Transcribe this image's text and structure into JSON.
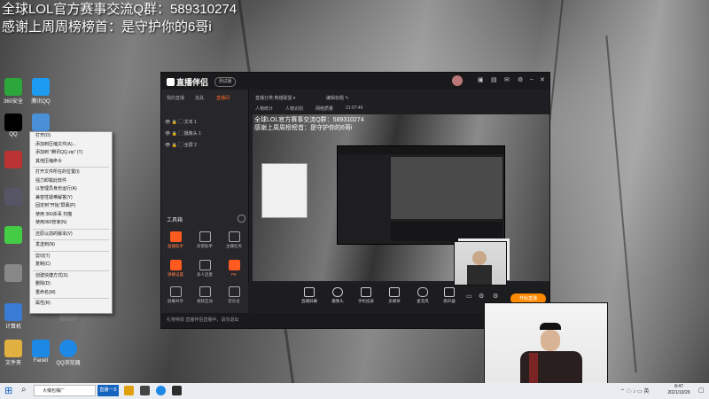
{
  "overlay": {
    "line1": "全球LOL官方赛事交流Q群：589310274",
    "line2": "感谢上周周榜榜首：是守护你的6哥i"
  },
  "desktop_icons": [
    {
      "label": "360安全",
      "color": "#2aa63a"
    },
    {
      "label": "腾讯QQ",
      "color": "#1d9bf0"
    },
    {
      "label": "QQ",
      "color": "#000000"
    },
    {
      "label": "回收站",
      "color": "#4a90d9"
    },
    {
      "label": "计算机",
      "color": "#3a7bd5"
    },
    {
      "label": "文件夹",
      "color": "#e0b040"
    },
    {
      "label": "Steam",
      "color": "#1b2838"
    },
    {
      "label": "Faceit",
      "color": "#ff5500"
    },
    {
      "label": "QQ浏览器",
      "color": "#1e88e5"
    }
  ],
  "context_menu": {
    "items": [
      "打开(O)",
      "添加到压缩文件(A)...",
      "添加到 \"腾讯QQ.zip\" (T)",
      "其他压缩命令",
      "",
      "打开文件所在的位置(I)",
      "强力卸载此软件",
      "以管理员身份运行(A)",
      "兼容性疑难解答(Y)",
      "固定到\"开始\"屏幕(P)",
      "使用 360杀毒 扫描",
      "使用360管家(N)",
      "",
      "还原以前的版本(V)",
      "",
      "发送到(N)",
      "",
      "剪切(T)",
      "复制(C)",
      "",
      "创建快捷方式(S)",
      "删除(D)",
      "重命名(M)",
      "",
      "属性(R)"
    ]
  },
  "app": {
    "name": "直播伴侣",
    "version": "测试版",
    "tabs": [
      "我的直播",
      "道具",
      "直播间"
    ],
    "scenes": [
      "文本 1",
      "摄像头 1",
      "全屏 2"
    ],
    "header": {
      "room_title": "直播分类:英雄联盟 ▾",
      "edit": "编辑标题 ✎",
      "status1": "人物统计",
      "status2": "人物识别",
      "status3": "网络质量",
      "time": "21:07:40"
    },
    "tools_title": "工具箱",
    "tools": [
      "直播助手",
      "房管助手",
      "主播任务",
      "弹幕设置",
      "多人连麦",
      "PK",
      "屏幕共享",
      "视频互动",
      "音乐台",
      "提示",
      "下载",
      "更多"
    ],
    "bottom_buttons": [
      "直播屏幕",
      "摄像头",
      "手机投屏",
      "多媒体",
      "麦克风",
      "扬声器"
    ],
    "start_live": "开始直播",
    "status_text": "礼物特效   直播伴侣直播中，请勿退出"
  },
  "taskbar": {
    "search_text": "大桶包桶厂",
    "active_label": "直播一:5",
    "time": "8:47",
    "date": "2021/10/29"
  }
}
